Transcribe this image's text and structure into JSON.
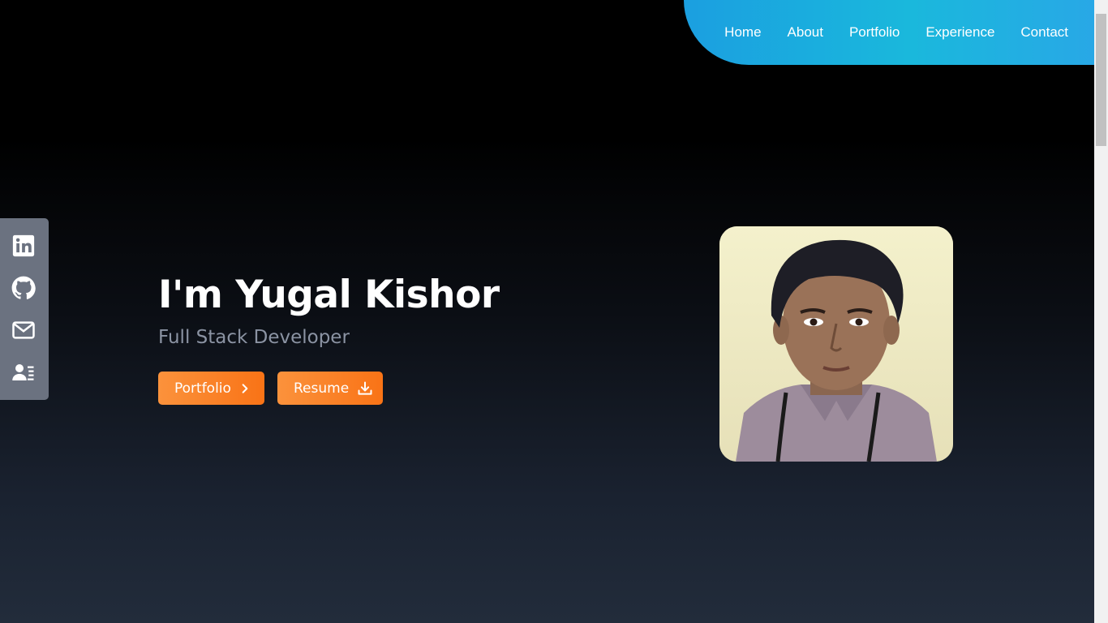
{
  "nav": {
    "items": [
      {
        "label": "Home"
      },
      {
        "label": "About"
      },
      {
        "label": "Portfolio"
      },
      {
        "label": "Experience"
      },
      {
        "label": "Contact"
      }
    ]
  },
  "social": {
    "items": [
      {
        "icon": "linkedin-icon"
      },
      {
        "icon": "github-icon"
      },
      {
        "icon": "mail-icon"
      },
      {
        "icon": "resume-contact-icon"
      }
    ]
  },
  "hero": {
    "title": "I'm Yugal Kishor",
    "subtitle": "Full Stack Developer",
    "portfolio_button": "Portfolio",
    "resume_button": "Resume"
  },
  "colors": {
    "nav_gradient": "#1ab8dc",
    "accent": "#f97316",
    "social_bar": "#6b7280",
    "subtitle": "#8b93a3"
  }
}
